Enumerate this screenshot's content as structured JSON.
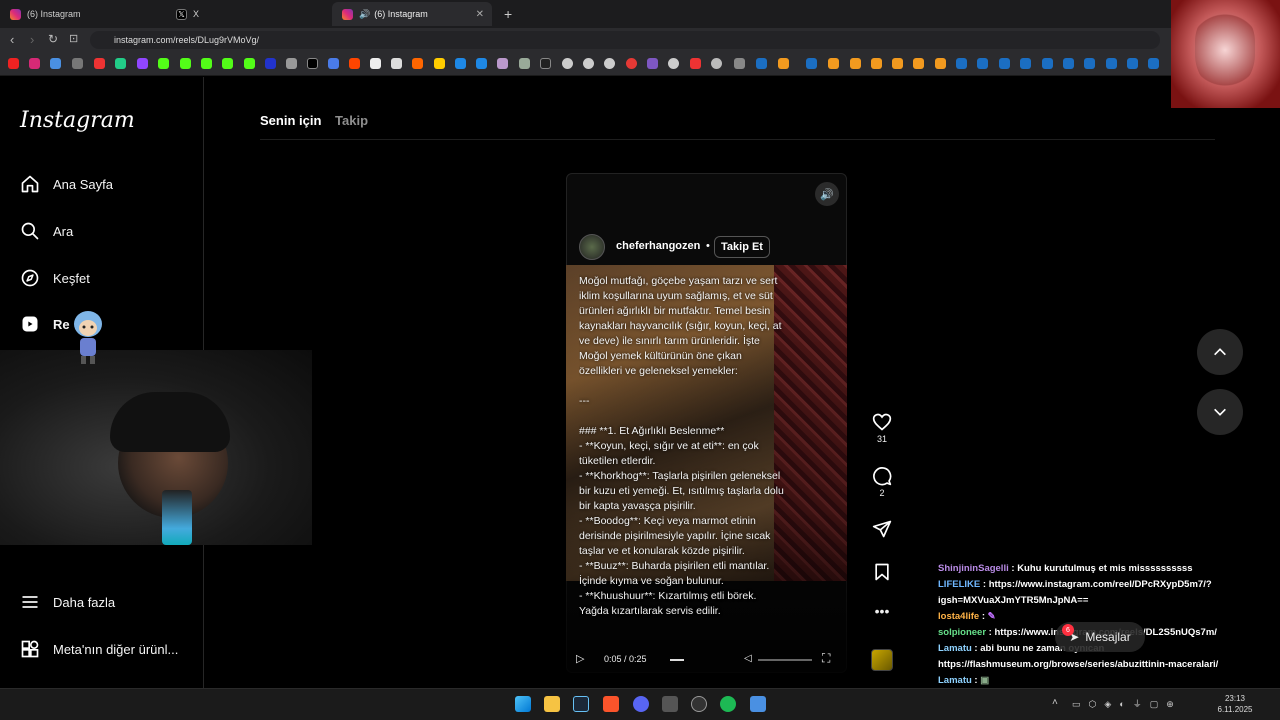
{
  "browser": {
    "tabs": [
      {
        "title": "(6) Instagram",
        "active": false
      },
      {
        "title": "X",
        "active": false
      },
      {
        "title": "(6) Instagram",
        "active": true
      }
    ],
    "url": "instagram.com/reels/DLug9rVMoVg/"
  },
  "sidebar": {
    "logo": "Instagram",
    "items": [
      {
        "label": "Ana Sayfa",
        "icon": "home-icon"
      },
      {
        "label": "Ara",
        "icon": "search-icon"
      },
      {
        "label": "Keşfet",
        "icon": "compass-icon"
      },
      {
        "label": "Re",
        "icon": "reels-icon"
      },
      {
        "label": "Daha fazla",
        "icon": "menu-icon"
      },
      {
        "label": "Meta'nın diğer ürünl...",
        "icon": "meta-apps-icon"
      }
    ]
  },
  "feed_tabs": {
    "for_you": "Senin için",
    "following": "Takip"
  },
  "reel": {
    "username": "cheferhangozen",
    "separator": "•",
    "follow_label": "Takip Et",
    "caption": "Moğol mutfağı, göçebe yaşam tarzı ve sert iklim koşullarına uyum sağlamış, et ve süt ürünleri ağırlıklı bir mutfaktır. Temel besin kaynakları hayvancılık (sığır, koyun, keçi, at ve deve) ile sınırlı tarım ürünleridir. İşte Moğol yemek kültürünün öne çıkan özellikleri ve geleneksel yemekler:\n\n---\n\n### **1. Et Ağırlıklı Beslenme**\n- **Koyun, keçi, sığır ve at eti**: en çok tüketilen etlerdir.\n- **Khorkhog**: Taşlarla pişirilen geleneksel bir kuzu eti yemeği. Et, ısıtılmış taşlarla dolu bir kapta yavaşça pişirilir.\n- **Boodog**: Keçi veya marmot etinin derisinde pişirilmesiyle yapılır. İçine sıcak taşlar ve et konularak közde pişirilir.\n- **Buuz**: Buharda pişirilen etli mantılar. İçinde kıyma ve soğan bulunur.\n- **Khuushuur**: Kızartılmış etli börek. Yağda kızartılarak servis edilir.",
    "time": "0:05 / 0:25",
    "likes": "31",
    "comments": "2"
  },
  "chat": [
    {
      "user": "ShinjininSagelli",
      "text": "Kuhu kurutulmuş et mis missssssssss",
      "color": "u1"
    },
    {
      "user": "LIFELIKE",
      "text": "https://www.instagram.com/reel/DPcRXypD5m7/?igsh=MXVuaXJmYTR5MnJpNA==",
      "color": "u2"
    },
    {
      "user": "losta4life",
      "text": "",
      "color": "u3"
    },
    {
      "user": "solpioneer",
      "text": "https://www.instagram.com/reels/DL2S5nUQs7m/",
      "color": "u4"
    },
    {
      "user": "Lamatu",
      "text": "abi bunu ne zaman oynıcan https://flashmuseum.org/browse/series/abuzittinin-maceralari/",
      "color": "u5"
    },
    {
      "user": "Lamatu",
      "text": "",
      "color": "u5"
    }
  ],
  "messages": {
    "label": "Mesajlar",
    "badge": "6"
  },
  "clock": {
    "time": "23:13",
    "date": "6.11.2025"
  }
}
